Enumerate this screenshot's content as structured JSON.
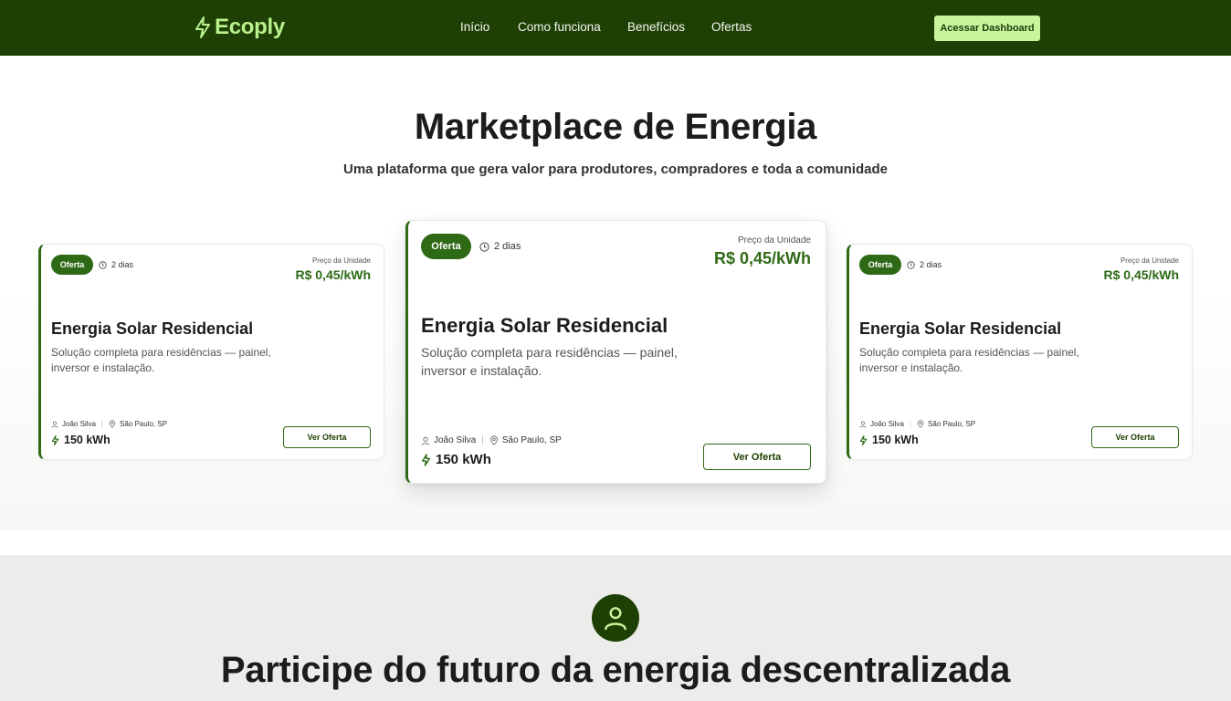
{
  "brand": {
    "name": "Ecoply"
  },
  "nav": {
    "links": [
      "Início",
      "Como funciona",
      "Benefícios",
      "Ofertas"
    ],
    "cta": "Acessar Dashboard"
  },
  "hero": {
    "title": "Marketplace de Energia",
    "subtitle": "Uma plataforma que gera valor para produtores, compradores e toda a comunidade"
  },
  "offers": [
    {
      "badge": "Oferta",
      "time": "2 dias",
      "price_label": "Preço da Unidade",
      "price": "R$ 0,45/kWh",
      "title": "Energia Solar Residencial",
      "description": "Solução completa para residências — painel, inversor e instalação.",
      "seller": "João Silva",
      "location": "São Paulo, SP",
      "amount": "150 kWh",
      "button": "Ver Oferta"
    },
    {
      "badge": "Oferta",
      "time": "2 dias",
      "price_label": "Preço da Unidade",
      "price": "R$ 0,45/kWh",
      "title": "Energia Solar Residencial",
      "description": "Solução completa para residências — painel, inversor e instalação.",
      "seller": "João Silva",
      "location": "São Paulo, SP",
      "amount": "150 kWh",
      "button": "Ver Oferta"
    },
    {
      "badge": "Oferta",
      "time": "2 dias",
      "price_label": "Preço da Unidade",
      "price": "R$ 0,45/kWh",
      "title": "Energia Solar Residencial",
      "description": "Solução completa para residências — painel, inversor e instalação.",
      "seller": "João Silva",
      "location": "São Paulo, SP",
      "amount": "150 kWh",
      "button": "Ver Oferta"
    }
  ],
  "cta_section": {
    "title": "Participe do futuro da energia descentralizada",
    "icon": "user-icon"
  },
  "colors": {
    "nav_bg": "#1f4004",
    "accent": "#2e6a16",
    "logo": "#b9f18d",
    "cta_button": "#c6f59c",
    "section_bg": "#ecedea"
  }
}
